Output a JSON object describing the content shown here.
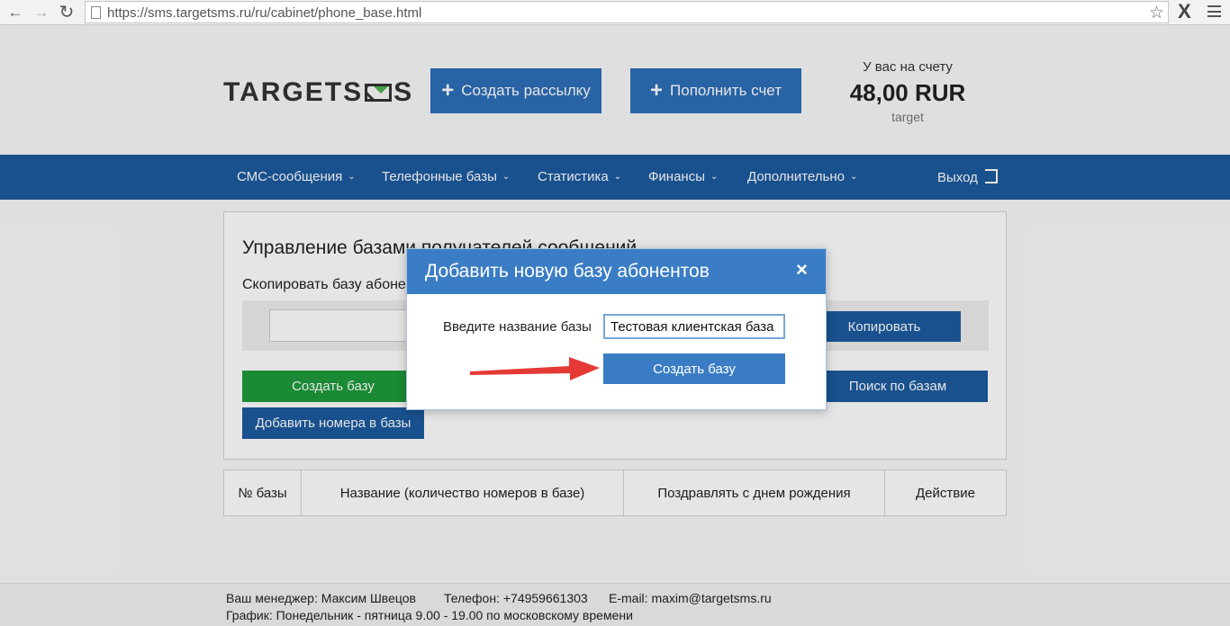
{
  "browser": {
    "url": "https://sms.targetsms.ru/ru/cabinet/phone_base.html",
    "ext_icon": "X"
  },
  "header": {
    "logo_left": "TARGETS",
    "logo_right": "S",
    "create_mailing_label": "Создать рассылку",
    "top_up_label": "Пополнить счет",
    "balance_label": "У вас на счету",
    "balance_value": "48,00 RUR",
    "account_name": "target"
  },
  "nav": {
    "items": [
      {
        "label": "СМС-сообщения"
      },
      {
        "label": "Телефонные базы"
      },
      {
        "label": "Статистика"
      },
      {
        "label": "Финансы"
      },
      {
        "label": "Дополнительно"
      }
    ],
    "logout_label": "Выход"
  },
  "panel": {
    "title": "Управление базами получателей сообщений",
    "copy_label": "Скопировать базу абонентов",
    "copy_button": "Копировать",
    "create_base_button": "Создать базу",
    "search_bases_button": "Поиск по базам",
    "add_numbers_button": "Добавить номера в базы"
  },
  "table": {
    "columns": [
      "№ базы",
      "Название (количество номеров в базе)",
      "Поздравлять с днем рождения",
      "Действие"
    ]
  },
  "footer": {
    "manager": "Ваш менеджер: Максим Швецов",
    "phone": "Телефон: +74959661303",
    "email": "E-mail: maxim@targetsms.ru",
    "schedule": "График: Понедельник - пятница 9.00 - 19.00 по московскому времени"
  },
  "modal": {
    "title": "Добавить новую базу абонентов",
    "close": "×",
    "name_label": "Введите название базы",
    "name_value": "Тестовая клиентская база",
    "create_button": "Создать базу"
  },
  "colors": {
    "primary_blue": "#1c5b9f",
    "modal_blue": "#3b7dc4",
    "green": "#1e9a3a",
    "arrow_red": "#e53935"
  }
}
